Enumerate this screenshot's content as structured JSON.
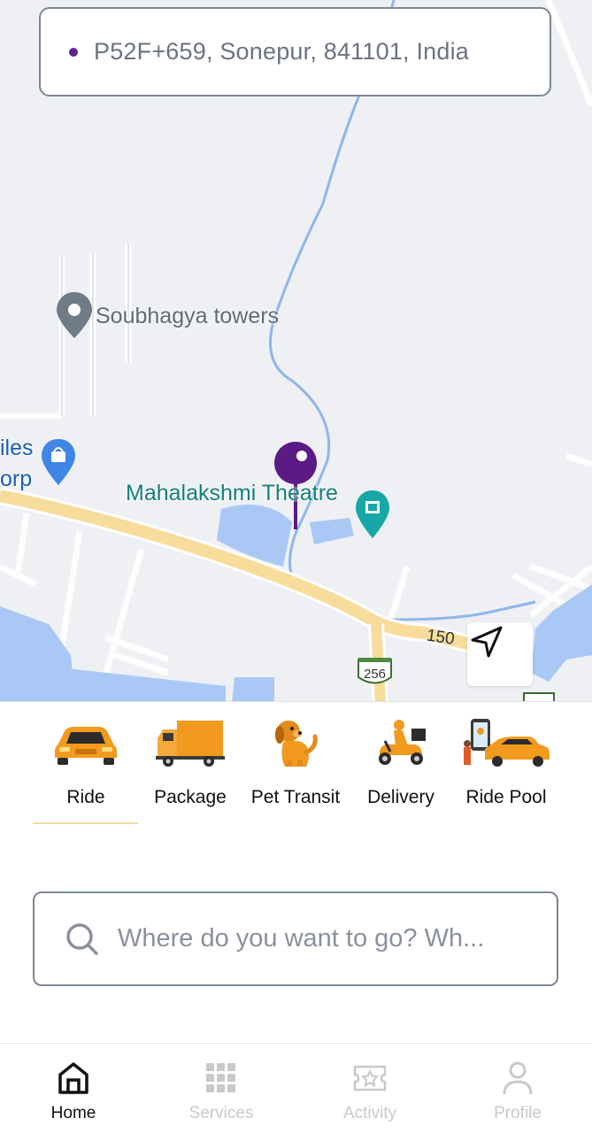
{
  "location_bar": {
    "address": "P52F+659, Sonepur, 841101, India"
  },
  "map": {
    "pois": [
      {
        "name": "Soubhagya towers",
        "color": "#5f6b76"
      },
      {
        "name": "Mahalakshmi Theatre",
        "color": "#13807a"
      },
      {
        "name": "iles",
        "color": "#1a5fb4"
      },
      {
        "name": "orp",
        "color": "#1a5fb4"
      }
    ],
    "road_labels": [
      "150",
      "256"
    ],
    "pin_color": "#5b1a86"
  },
  "services": [
    {
      "label": "Ride",
      "icon": "car-icon",
      "selected": true
    },
    {
      "label": "Package",
      "icon": "truck-icon",
      "selected": false
    },
    {
      "label": "Pet Transit",
      "icon": "dog-icon",
      "selected": false
    },
    {
      "label": "Delivery",
      "icon": "scooter-icon",
      "selected": false
    },
    {
      "label": "Ride Pool",
      "icon": "ride-pool-icon",
      "selected": false
    }
  ],
  "search": {
    "placeholder": "Where do you want to go? Wh..."
  },
  "bottom_nav": [
    {
      "label": "Home",
      "icon": "home-icon",
      "active": true
    },
    {
      "label": "Services",
      "icon": "grid-icon",
      "active": false
    },
    {
      "label": "Activity",
      "icon": "ticket-icon",
      "active": false
    },
    {
      "label": "Profile",
      "icon": "person-icon",
      "active": false
    }
  ],
  "colors": {
    "accent": "#f29a1d",
    "primary": "#5b1a86",
    "road": "#f7dc9b",
    "water": "#a9c8f5"
  }
}
